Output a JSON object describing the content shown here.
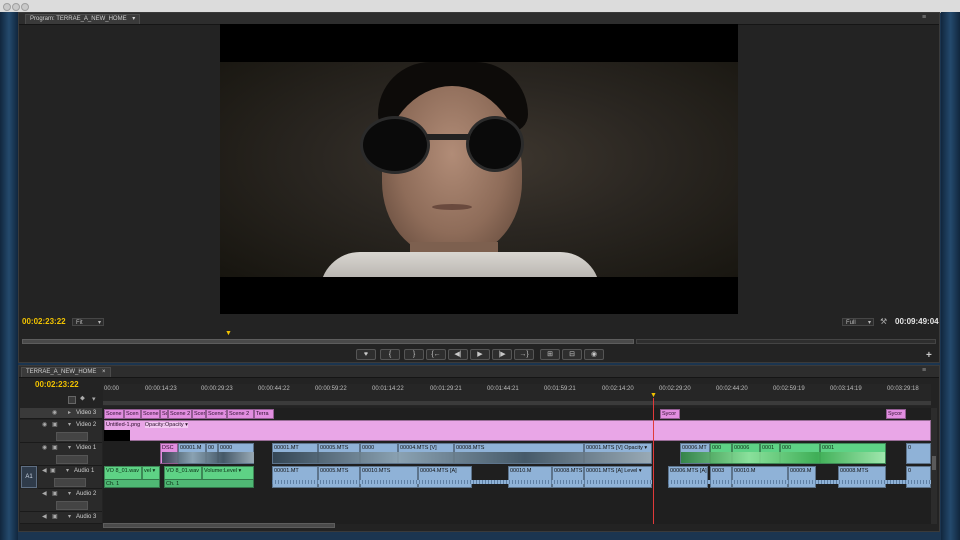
{
  "program_monitor": {
    "tab_label": "Program: TERRAE_A_NEW_HOME",
    "tab_arrow": "▾",
    "current_timecode": "00:02:23:22",
    "fit_select": "Fit",
    "quality_select": "Full",
    "duration_timecode": "00:09:49:04"
  },
  "transport": {
    "buttons": [
      "♥",
      "{",
      "}",
      "{←",
      "◀|",
      "▶",
      "|▶",
      "→}",
      "⊞",
      "⊟",
      "◉"
    ]
  },
  "timeline": {
    "tab_label": "TERRAE_A_NEW_HOME",
    "tab_close": "×",
    "timecode": "00:02:23:22",
    "ruler": [
      "00:00",
      "00:00:14:23",
      "00:00:29:23",
      "00:00:44:22",
      "00:00:59:22",
      "00:01:14:22",
      "00:01:29:21",
      "00:01:44:21",
      "00:01:59:21",
      "00:02:14:20",
      "00:02:29:20",
      "00:02:44:20",
      "00:02:59:19",
      "00:03:14:19",
      "00:03:29:18"
    ],
    "tracks": [
      {
        "name": "Video 3",
        "toggle": "▸"
      },
      {
        "name": "Video 2",
        "toggle": "▾"
      },
      {
        "name": "Video 1",
        "toggle": "▾"
      },
      {
        "name": "Audio 1",
        "toggle": "▾",
        "patch": "A1"
      },
      {
        "name": "Audio 2",
        "toggle": "▾"
      },
      {
        "name": "Audio 3",
        "toggle": "▾"
      }
    ],
    "clips": {
      "v3": [
        "Scene",
        "Scen",
        "Scene",
        "Sc",
        "Scene 2",
        "Scen",
        "Scene 2",
        "Scene 2 ",
        "Terra",
        "Sycor",
        "Sycor"
      ],
      "v2": [
        "Untitled-1.png",
        "Opacity:Opacity ▾"
      ],
      "v1": [
        "DSC",
        "00001.M",
        "00",
        "0000",
        "00001.MT",
        "00005.MTS",
        "0000",
        "00004.MTS [V]",
        "00008.MTS",
        "00001.MTS [V] Opacity ▾",
        "00006.MT",
        "000",
        "00006",
        "0001",
        "000",
        "0001",
        "0"
      ],
      "a1": [
        "VO 8_01.wav",
        "vel ▾",
        "VO 8_01.wav",
        "Volume:Level ▾",
        "00001.MT",
        "00005.MTS",
        "00010.MTS",
        "00004.MTS [A]",
        "00010.M",
        "00008.MTS",
        "00001.MTS [A] Level ▾",
        "00006.MTS [A]",
        "0003",
        "00010.M",
        "00009.M",
        "00008.MTS",
        "0"
      ],
      "a1_channel": [
        "Ch. 1",
        "Ch. 1"
      ]
    }
  },
  "colors": {
    "timecode": "#f2c300",
    "clip_pink": "#e28ee0",
    "clip_blue": "#8fb2d7",
    "clip_green": "#5ed285",
    "playhead": "#e03a3a"
  }
}
